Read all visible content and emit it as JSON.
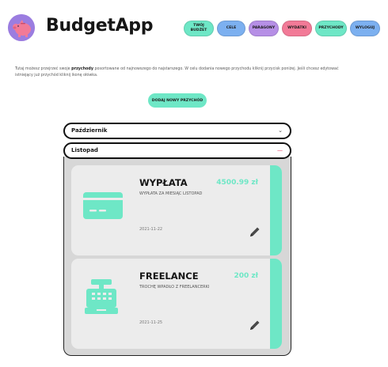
{
  "app": {
    "name": "BudgetApp"
  },
  "nav": [
    {
      "label": "TWÓJ BUDŻET",
      "color": "#6ee7c6"
    },
    {
      "label": "CELE",
      "color": "#7cb0f0"
    },
    {
      "label": "PARAGONY",
      "color": "#b68fe6"
    },
    {
      "label": "WYDATKI",
      "color": "#f27a97"
    },
    {
      "label": "PRZYCHODY",
      "color": "#6ee7c6"
    },
    {
      "label": "WYLOGUJ",
      "color": "#7cb0f0"
    }
  ],
  "intro": {
    "part1": "Tutaj możesz przejrzeć swoje ",
    "bold": "przychody",
    "part2": " posortowane od najnowszego do najstarszego. W celu dodania nowego przychodu kliknij przycisk poniżej. Jeśli chcesz edytować istniejący już przychód kliknij ikonę ołówka."
  },
  "add_button": {
    "label": "DODAJ NOWY PRZYCHÓD"
  },
  "months": [
    {
      "name": "Październik",
      "toggle": "⌄",
      "expanded": false
    },
    {
      "name": "Listopad",
      "toggle": "—",
      "expanded": true
    }
  ],
  "incomes": [
    {
      "title": "WYPŁATA",
      "amount": "4500.99 zł",
      "description": "WYPŁATA ZA MIESIĄC LISTOPAD",
      "date": "2021-11-22",
      "icon": "credit-card-icon"
    },
    {
      "title": "FREELANCE",
      "amount": "200 zł",
      "description": "TROCHĘ WPADŁO Z FREELANCERKI",
      "date": "2021-11-25",
      "icon": "cash-register-icon"
    }
  ],
  "colors": {
    "accent": "#6ee7c6",
    "panel": "#d7d7d7",
    "card": "#ececec",
    "collapse": "#e0305a"
  }
}
